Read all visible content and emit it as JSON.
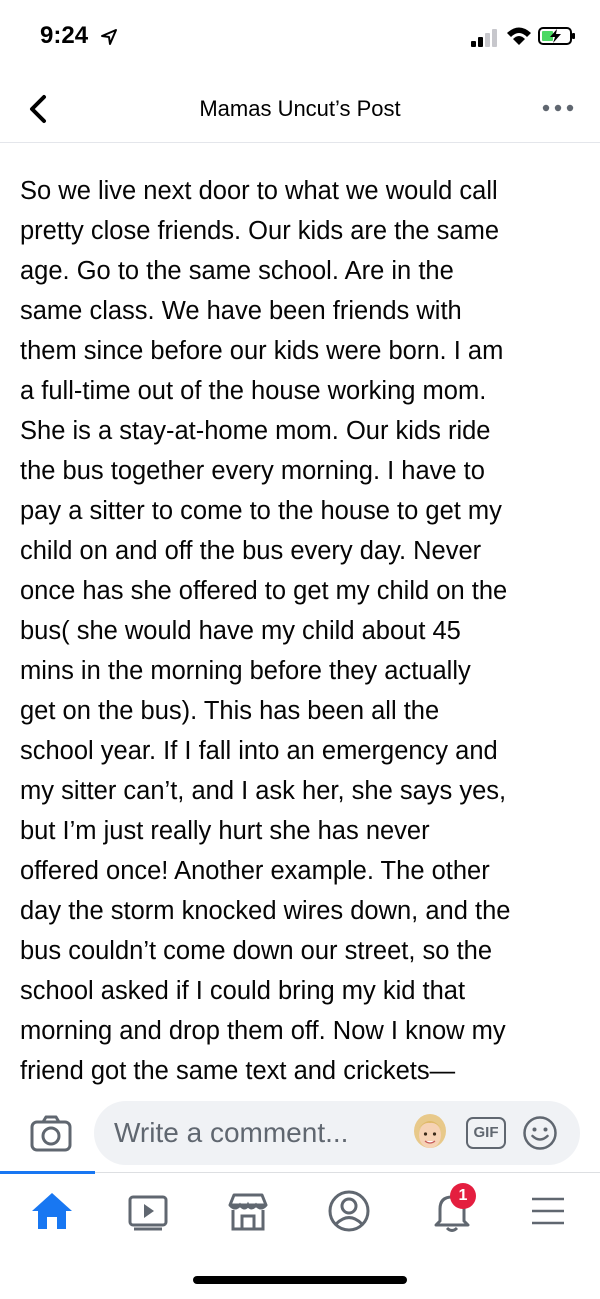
{
  "status_bar": {
    "time": "9:24",
    "icons": [
      "location-arrow-icon",
      "signal-icon",
      "wifi-icon",
      "battery-charging-icon"
    ]
  },
  "header": {
    "title": "Mamas Uncut’s Post",
    "back_icon": "chevron-left-icon",
    "more_icon": "more-dots-icon"
  },
  "post": {
    "lines": [
      "So we live next door to what we would call",
      "pretty close friends. Our kids are the same",
      "age. Go to the same school. Are in the",
      "same class. We have been friends with",
      "them since before our kids were born. I am",
      "a full-time out of the house working mom.",
      "She is a stay-at-home mom. Our kids ride",
      "the bus together every morning. I have to",
      "pay a sitter to come to the house to get my",
      "child on and off the bus every day. Never",
      "once has she offered to get my child on the",
      "bus( she would have my child about 45",
      "mins in the morning before they actually",
      "get on the bus). This has been all the",
      "school year. If I fall into an emergency and",
      "my sitter can’t, and I ask her, she says yes,",
      "but I’m just really hurt she has never",
      "offered once! Another example. The other",
      "day the storm knocked wires down, and the",
      "bus couldn’t come down our street, so the",
      "school asked if I could bring my kid that",
      "morning and drop them off. Now I know my",
      "friend got the same text and crickets—"
    ]
  },
  "comment_bar": {
    "placeholder": "Write a comment...",
    "gif_label": "GIF",
    "icons": [
      "camera-icon",
      "avatar-sticker-icon",
      "gif-icon",
      "smile-icon"
    ]
  },
  "tab_bar": {
    "tabs": [
      "home-icon",
      "watch-icon",
      "marketplace-icon",
      "profile-icon",
      "notifications-icon",
      "menu-icon"
    ],
    "active": "home",
    "notification_count": "1"
  },
  "colors": {
    "accent": "#1877f2",
    "badge": "#e41e3f",
    "input_bg": "#f0f2f5",
    "icon_gray": "#606770"
  }
}
